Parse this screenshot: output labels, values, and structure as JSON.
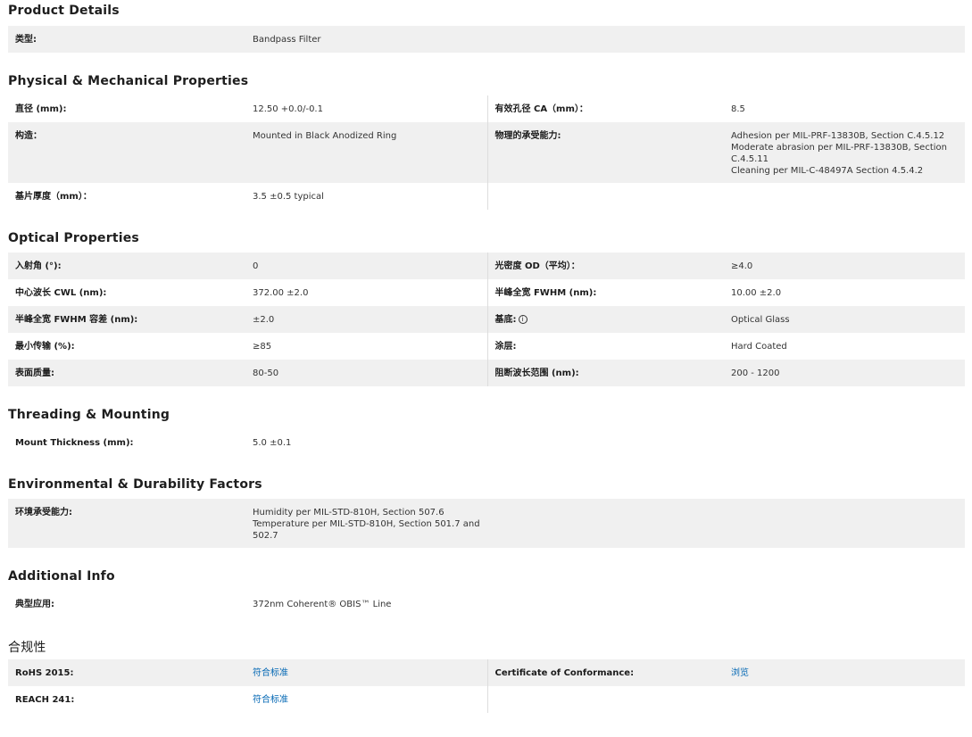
{
  "product_details": {
    "title": "Product Details",
    "type_label": "类型:",
    "type_value": "Bandpass Filter"
  },
  "physical": {
    "title": "Physical & Mechanical Properties",
    "diameter_label": "直径 (mm):",
    "diameter_value": "12.50 +0.0/-0.1",
    "ca_label": "有效孔径 CA（mm）：",
    "ca_value": "8.5",
    "construction_label": "构造：",
    "construction_value": "Mounted in Black Anodized Ring",
    "durability_label": "物理的承受能力:",
    "durability_lines": [
      "Adhesion per MIL-PRF-13830B, Section C.4.5.12",
      "Moderate abrasion per MIL-PRF-13830B, Section C.4.5.11",
      "Cleaning per MIL-C-48497A Section 4.5.4.2"
    ],
    "thickness_label": "基片厚度（mm）：",
    "thickness_value": "3.5 ±0.5 typical"
  },
  "optical": {
    "title": "Optical Properties",
    "rows": [
      {
        "l1": "入射角 (°):",
        "v1": "0",
        "l2": "光密度 OD（平均）：",
        "v2": "≥4.0"
      },
      {
        "l1": "中心波长 CWL (nm):",
        "v1": "372.00 ±2.0",
        "l2": "半峰全宽 FWHM (nm):",
        "v2": "10.00 ±2.0"
      },
      {
        "l1": "半峰全宽 FWHM 容差 (nm):",
        "v1": "±2.0",
        "l2": "基底:",
        "v2": "Optical Glass"
      },
      {
        "l1": "最小传输 (%):",
        "v1": "≥85",
        "l2": "涂层:",
        "v2": "Hard Coated"
      },
      {
        "l1": "表面质量:",
        "v1": "80-50",
        "l2": "阻断波长范围 (nm):",
        "v2": "200 - 1200"
      }
    ],
    "info_glyph": "i"
  },
  "threading": {
    "title": "Threading & Mounting",
    "mount_label": "Mount Thickness (mm):",
    "mount_value": "5.0 ±0.1"
  },
  "environmental": {
    "title": "Environmental & Durability Factors",
    "env_label": "环境承受能力:",
    "env_lines": [
      "Humidity per MIL-STD-810H, Section 507.6",
      "Temperature per MIL-STD-810H, Section 501.7 and 502.7"
    ]
  },
  "additional": {
    "title": "Additional Info",
    "app_label": "典型应用:",
    "app_value": "372nm Coherent® OBIS™ Line"
  },
  "compliance": {
    "title": "合规性",
    "rohs_label": "RoHS 2015:",
    "rohs_link": "符合标准",
    "cert_label": "Certificate of Conformance:",
    "cert_link": "浏览",
    "reach_label": "REACH 241:",
    "reach_link": "符合标准"
  }
}
